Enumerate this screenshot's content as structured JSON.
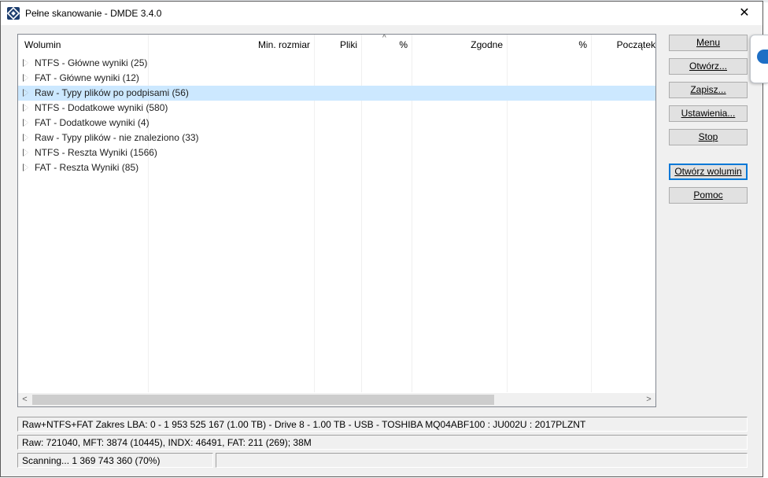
{
  "window": {
    "title": "Pełne skanowanie - DMDE 3.4.0",
    "close_glyph": "✕",
    "app_icon": "dmde-app-icon"
  },
  "table": {
    "columns": [
      "Wolumin",
      "Min. rozmiar",
      "Pliki",
      "%",
      "Zgodne",
      "%",
      "Początek"
    ],
    "sort_indicator": "^",
    "rows": [
      {
        "label": "NTFS - Główne wyniki (25)",
        "selected": false
      },
      {
        "label": "FAT - Główne wyniki (12)",
        "selected": false
      },
      {
        "label": "Raw - Typy plików po podpisami (56)",
        "selected": true
      },
      {
        "label": "NTFS - Dodatkowe wyniki (580)",
        "selected": false
      },
      {
        "label": "FAT - Dodatkowe wyniki (4)",
        "selected": false
      },
      {
        "label": "Raw - Typy plików - nie znaleziono (33)",
        "selected": false
      },
      {
        "label": "NTFS - Reszta Wyniki (1566)",
        "selected": false
      },
      {
        "label": "FAT - Reszta Wyniki (85)",
        "selected": false
      }
    ],
    "scroll_left": "<",
    "scroll_right": ">"
  },
  "buttons": {
    "menu": "Menu",
    "open": "Otwórz...",
    "save": "Zapisz...",
    "settings": "Ustawienia...",
    "stop": "Stop",
    "open_volume": "Otwórz wolumin",
    "help": "Pomoc"
  },
  "status": {
    "line1": "Raw+NTFS+FAT Zakres LBA: 0 - 1 953 525 167 (1.00 TB) - Drive 8 - 1.00 TB - USB - TOSHIBA MQ04ABF100 : JU002U : 2017PLZNT",
    "line2": "Raw: 721040, MFT: 3874 (10445), INDX: 46491, FAT: 211 (269); 38M",
    "line3": "Scanning... 1 369 743 360 (70%)",
    "line3_right": ""
  },
  "colors": {
    "selection": "#cce8ff",
    "focus_border": "#0078d7",
    "background_accent": "#1e6fc5"
  }
}
